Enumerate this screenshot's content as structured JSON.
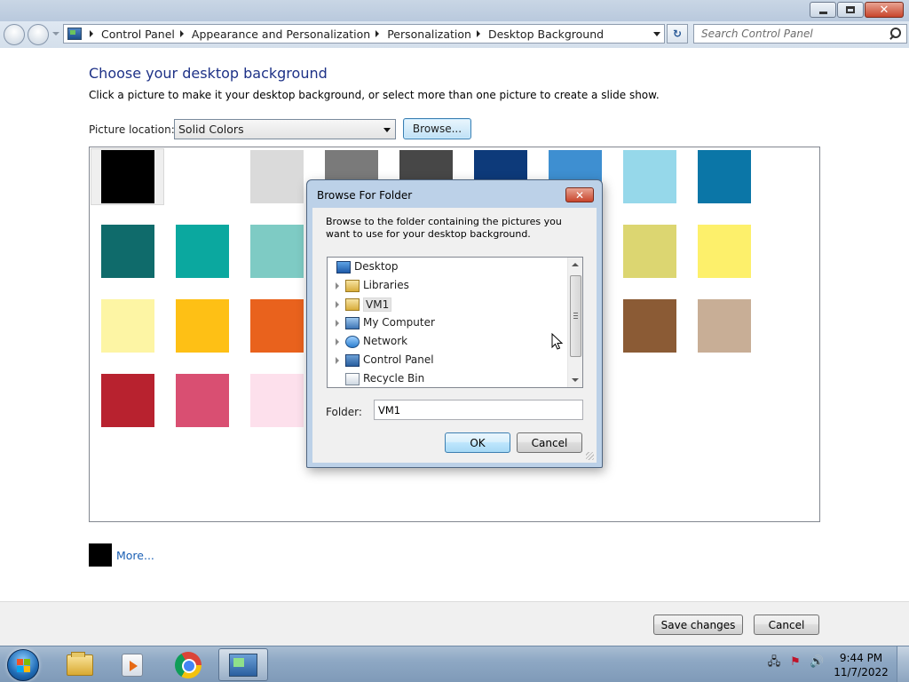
{
  "window": {
    "minimize_glyph": "minimize-icon",
    "maximize_glyph": "restore-icon",
    "close_glyph": "close-icon"
  },
  "address_bar": {
    "breadcrumbs": [
      "Control Panel",
      "Appearance and Personalization",
      "Personalization",
      "Desktop Background"
    ],
    "search_placeholder": "Search Control Panel"
  },
  "main": {
    "title": "Choose your desktop background",
    "subtitle": "Click a picture to make it your desktop background, or select more than one picture to create a slide show.",
    "picture_location_label": "Picture location:",
    "picture_location_value": "Solid Colors",
    "browse_label": "Browse...",
    "more_label": "More...",
    "more_swatch_color": "#000000"
  },
  "swatches": [
    {
      "color": "#000000",
      "row": 0,
      "col": 0,
      "selected": true
    },
    {
      "color": "#ffffff",
      "row": 0,
      "col": 1
    },
    {
      "color": "#dadada",
      "row": 0,
      "col": 2
    },
    {
      "color": "#7a7a7a",
      "row": 0,
      "col": 3
    },
    {
      "color": "#474747",
      "row": 0,
      "col": 4
    },
    {
      "color": "#0d3a7a",
      "row": 0,
      "col": 5
    },
    {
      "color": "#3e8fd1",
      "row": 0,
      "col": 6
    },
    {
      "color": "#96d8ea",
      "row": 0,
      "col": 7
    },
    {
      "color": "#0b76a7",
      "row": 0,
      "col": 8
    },
    {
      "color": "#0f6b6b",
      "row": 1,
      "col": 0
    },
    {
      "color": "#0ba89f",
      "row": 1,
      "col": 1
    },
    {
      "color": "#7ecbc4",
      "row": 1,
      "col": 2
    },
    {
      "color": "#dcd671",
      "row": 1,
      "col": 7
    },
    {
      "color": "#fdf06b",
      "row": 1,
      "col": 8
    },
    {
      "color": "#fdf5a4",
      "row": 2,
      "col": 0
    },
    {
      "color": "#fec015",
      "row": 2,
      "col": 1
    },
    {
      "color": "#e9621d",
      "row": 2,
      "col": 2
    },
    {
      "color": "#8b5b35",
      "row": 2,
      "col": 7
    },
    {
      "color": "#c8ae96",
      "row": 2,
      "col": 8
    },
    {
      "color": "#b8222f",
      "row": 3,
      "col": 0
    },
    {
      "color": "#d94f72",
      "row": 3,
      "col": 1
    },
    {
      "color": "#fde0ec",
      "row": 3,
      "col": 2
    }
  ],
  "footer": {
    "save_label": "Save changes",
    "cancel_label": "Cancel"
  },
  "dialog": {
    "title": "Browse For Folder",
    "description": "Browse to the folder containing the pictures you want to use for your desktop background.",
    "tree": [
      {
        "label": "Desktop",
        "icon": "desktop-icon",
        "expander": false,
        "indent": 0
      },
      {
        "label": "Libraries",
        "icon": "libraries-icon",
        "expander": true,
        "indent": 1
      },
      {
        "label": "VM1",
        "icon": "user-folder-icon",
        "expander": true,
        "indent": 1,
        "selected": true
      },
      {
        "label": "My Computer",
        "icon": "computer-icon",
        "expander": true,
        "indent": 1
      },
      {
        "label": "Network",
        "icon": "network-icon",
        "expander": true,
        "indent": 1
      },
      {
        "label": "Control Panel",
        "icon": "control-panel-icon",
        "expander": true,
        "indent": 1
      },
      {
        "label": "Recycle Bin",
        "icon": "recycle-bin-icon",
        "expander": false,
        "indent": 1
      }
    ],
    "folder_label": "Folder:",
    "folder_value": "VM1",
    "ok_label": "OK",
    "cancel_label": "Cancel"
  },
  "taskbar": {
    "apps": [
      "windows-explorer-icon",
      "media-player-icon",
      "chrome-icon",
      "control-panel-icon"
    ],
    "time": "9:44 PM",
    "date": "11/7/2022",
    "tray_icons": [
      "network-tray-icon",
      "action-center-icon",
      "volume-icon"
    ]
  }
}
